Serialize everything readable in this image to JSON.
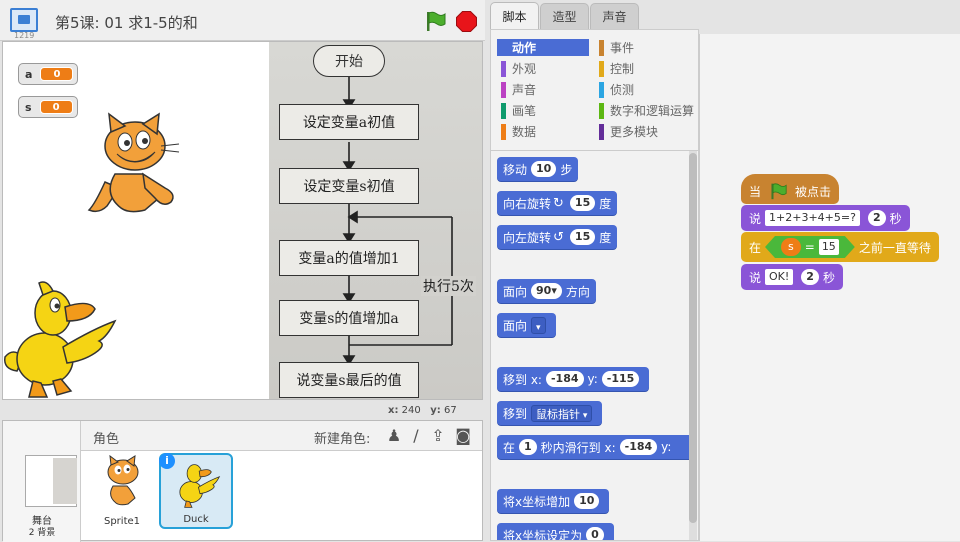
{
  "stage_header": {
    "version": "1219",
    "project_title": "第5课: 01 求1-5的和"
  },
  "variables": [
    {
      "name": "a",
      "value": "0"
    },
    {
      "name": "s",
      "value": "0"
    }
  ],
  "flowchart": {
    "start": "开始",
    "steps": [
      "设定变量a初值",
      "设定变量s初值",
      "变量a的值增加1",
      "变量s的值增加a",
      "说变量s最后的值"
    ],
    "loop_label": "执行5次"
  },
  "coords": {
    "x_label": "x:",
    "x": "240",
    "y_label": "y:",
    "y": "67"
  },
  "sprite_panel": {
    "title": "角色",
    "new_sprite": "新建角色:",
    "stage_name": "舞台",
    "stage_backdrops": "2 背景",
    "sprites": [
      {
        "name": "Sprite1"
      },
      {
        "name": "Duck"
      }
    ]
  },
  "tabs": [
    "脚本",
    "造型",
    "声音"
  ],
  "categories": [
    {
      "label": "动作",
      "color": "#4a6cd4"
    },
    {
      "label": "事件",
      "color": "#c88330"
    },
    {
      "label": "外观",
      "color": "#8a55d7"
    },
    {
      "label": "控制",
      "color": "#e1a91a"
    },
    {
      "label": "声音",
      "color": "#bb42c3"
    },
    {
      "label": "侦测",
      "color": "#2ca5e2"
    },
    {
      "label": "画笔",
      "color": "#0e9a6c"
    },
    {
      "label": "数字和逻辑运算",
      "color": "#5cb712"
    },
    {
      "label": "数据",
      "color": "#ee7d16"
    },
    {
      "label": "更多模块",
      "color": "#632d99"
    }
  ],
  "palette": {
    "move": {
      "a": "移动",
      "n": "10",
      "b": "步"
    },
    "turn_right": {
      "a": "向右旋转",
      "n": "15",
      "b": "度"
    },
    "turn_left": {
      "a": "向左旋转",
      "n": "15",
      "b": "度"
    },
    "point_dir": {
      "a": "面向",
      "n": "90",
      "b": "方向"
    },
    "point_towards": {
      "a": "面向"
    },
    "goto_xy": {
      "a": "移到 x:",
      "x": "-184",
      "b": "y:",
      "y": "-115"
    },
    "goto": {
      "a": "移到",
      "target": "鼠标指针"
    },
    "glide": {
      "a": "在",
      "n": "1",
      "b": "秒内滑行到 x:",
      "x": "-184",
      "c": "y:"
    },
    "change_x": {
      "a": "将x坐标增加",
      "n": "10"
    },
    "set_x": {
      "a": "将x坐标设定为",
      "n": "0"
    }
  },
  "script": {
    "hat": {
      "a": "当",
      "b": "被点击"
    },
    "say1": {
      "a": "说",
      "text": "1+2+3+4+5=?",
      "n": "2",
      "b": "秒"
    },
    "wait_until": {
      "a": "在",
      "var": "s",
      "op": "=",
      "val": "15",
      "b": "之前一直等待"
    },
    "say2": {
      "a": "说",
      "text": "OK!",
      "n": "2",
      "b": "秒"
    }
  }
}
